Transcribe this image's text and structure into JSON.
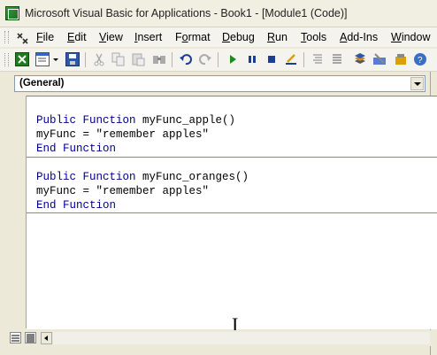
{
  "window": {
    "title": "Microsoft Visual Basic for Applications - Book1 - [Module1 (Code)]"
  },
  "menu": [
    {
      "label": "File",
      "accel": "F"
    },
    {
      "label": "Edit",
      "accel": "E"
    },
    {
      "label": "View",
      "accel": "V"
    },
    {
      "label": "Insert",
      "accel": "I"
    },
    {
      "label": "Format",
      "accel": "o"
    },
    {
      "label": "Debug",
      "accel": "D"
    },
    {
      "label": "Run",
      "accel": "R"
    },
    {
      "label": "Tools",
      "accel": "T"
    },
    {
      "label": "Add-Ins",
      "accel": "A"
    },
    {
      "label": "Window",
      "accel": "W"
    }
  ],
  "toolbar": {
    "icons": [
      "excel-view-icon",
      "insert-module-icon",
      "save-icon",
      "cut-icon",
      "copy-icon",
      "paste-icon",
      "find-icon",
      "undo-icon",
      "redo-icon",
      "run-icon",
      "break-icon",
      "reset-icon",
      "design-mode-icon",
      "project-explorer-icon",
      "properties-icon",
      "object-browser-icon",
      "toolbox-icon",
      "help-icon"
    ]
  },
  "object_combo": {
    "value": "(General)"
  },
  "code": {
    "proc1": {
      "kw1": "Public Function",
      "name": " myFunc_apple()",
      "body": "myFunc = \"remember apples\"",
      "end": "End Function"
    },
    "proc2": {
      "kw1": "Public Function",
      "name": " myFunc_oranges()",
      "body": "myFunc = \"remember apples\"",
      "end": "End Function"
    }
  },
  "colors": {
    "keyword": "#00008b",
    "title_bg": "#f1efe2",
    "chrome": "#ece9d8"
  }
}
